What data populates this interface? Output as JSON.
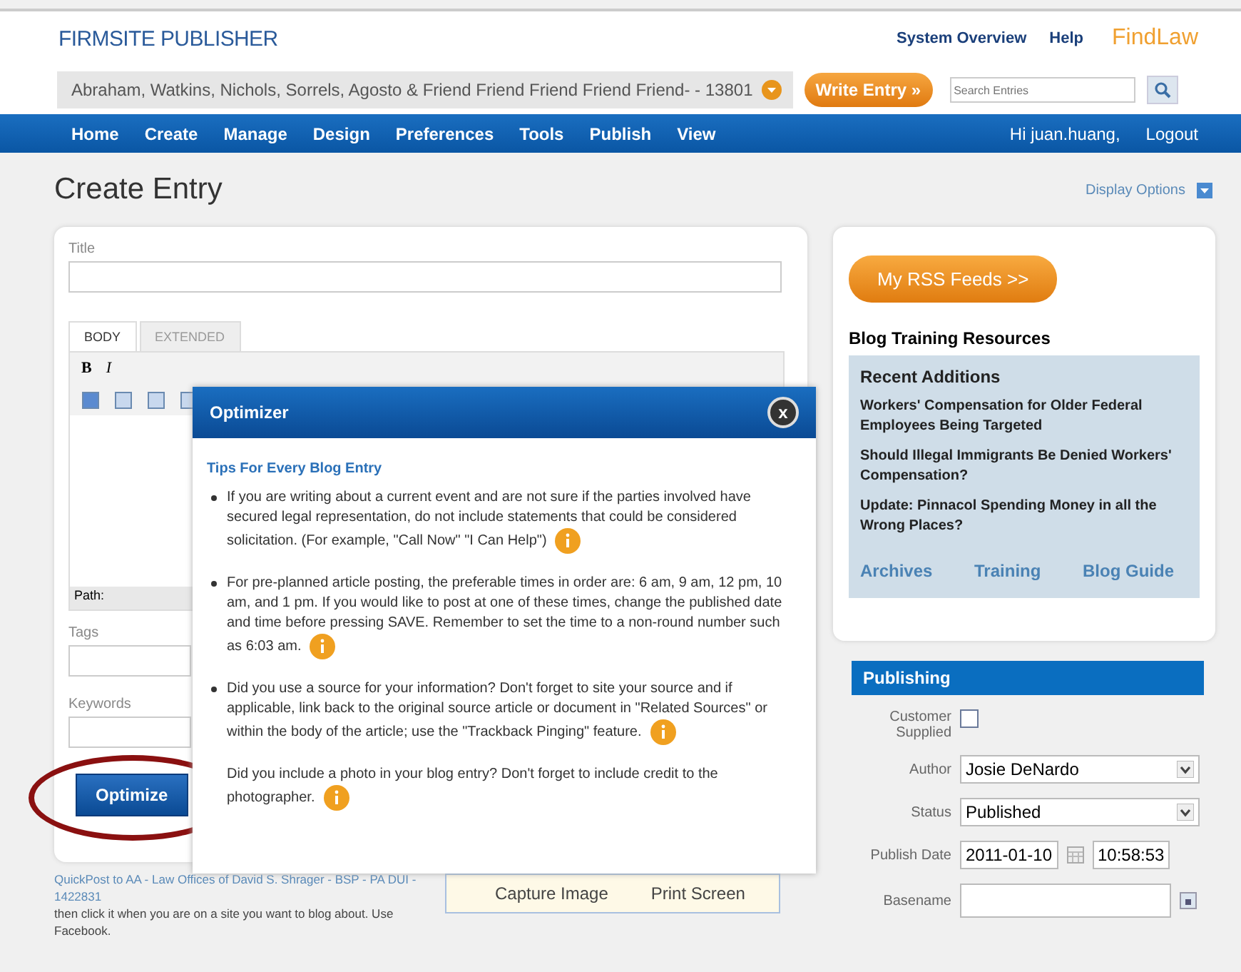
{
  "header": {
    "brand": "FIRMSITE PUBLISHER",
    "links": [
      "System Overview",
      "Help"
    ],
    "logo": "FindLaw",
    "firm_selector": "Abraham, Watkins, Nichols, Sorrels, Agosto & Friend Friend Friend Friend Friend- - 13801",
    "write_entry": "Write Entry »",
    "search_placeholder": "Search Entries"
  },
  "nav": {
    "items": [
      "Home",
      "Create",
      "Manage",
      "Design",
      "Preferences",
      "Tools",
      "Publish",
      "View"
    ],
    "greeting": "Hi juan.huang,",
    "logout": "Logout"
  },
  "page_title": "Create Entry",
  "display_options": "Display Options",
  "entry_form": {
    "title_label": "Title",
    "editor_tabs": [
      {
        "label": "BODY",
        "selected": true
      },
      {
        "label": "EXTENDED",
        "selected": false
      }
    ],
    "toolbar_buttons": [
      "B",
      "I"
    ],
    "path_label": "Path:",
    "tags_label": "Tags",
    "keywords_label": "Keywords",
    "optimize_button": "Optimize"
  },
  "footer": {
    "quickpost_link": "QuickPost to AA - Law Offices of David S. Shrager - BSP - PA DUI - 1422831",
    "lines": [
      "then click it when you are on a site you want to blog about. Use",
      "Facebook."
    ]
  },
  "capture_overlay": [
    "Capture Image",
    "Print Screen"
  ],
  "sidebar": {
    "rss_button": "My RSS Feeds >>",
    "resources_title": "Blog Training Resources",
    "recent_heading": "Recent Additions",
    "articles": [
      "Workers' Compensation for Older Federal Employees Being Targeted",
      "Should Illegal Immigrants Be Denied Workers' Compensation?",
      "Update: Pinnacol Spending Money in all the Wrong Places?"
    ],
    "links": [
      "Archives",
      "Training",
      "Blog Guide"
    ]
  },
  "publishing": {
    "title": "Publishing",
    "customer_supplied": {
      "label": "Customer Supplied",
      "checked": false
    },
    "author": {
      "label": "Author",
      "value": "Josie DeNardo"
    },
    "status": {
      "label": "Status",
      "value": "Published"
    },
    "publish_date": {
      "label": "Publish Date",
      "date": "2011-01-10",
      "time": "10:58:53"
    },
    "basename": {
      "label": "Basename"
    }
  },
  "optimizer": {
    "title": "Optimizer",
    "close": "x",
    "tips_heading": "Tips For Every Blog Entry",
    "tips": [
      {
        "text": "If you are writing about a current event and are not sure if the parties involved have secured legal representation, do not include statements that could be considered solicitation. (For example, \"Call Now\" \"I Can Help\")",
        "bulleted": true
      },
      {
        "text": "For pre-planned article posting, the preferable times in order are: 6 am, 9 am, 12 pm, 10 am, and 1 pm. If you would like to post at one of these times, change the published date and time before pressing SAVE. Remember to set the time to a non-round number such as 6:03 am.",
        "bulleted": true
      },
      {
        "text": "Did you use a source for your information? Don't forget to site your source and if applicable, link back to the original source article or document in \"Related Sources\" or within the body of the article; use the \"Trackback Pinging\" feature.",
        "bulleted": true
      },
      {
        "text": "Did you include a photo in your blog entry? Don't forget to include credit to the photographer.",
        "bulleted": false
      }
    ]
  }
}
